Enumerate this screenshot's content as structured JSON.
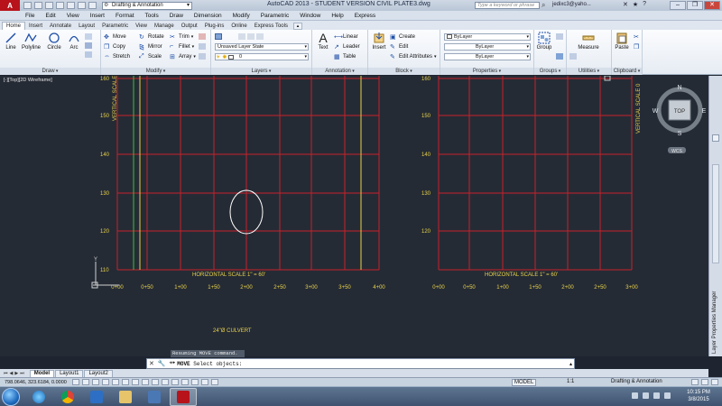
{
  "titlebar": {
    "logo": "A",
    "workspace": "Drafting & Annotation",
    "title": "AutoCAD 2013 - STUDENT VERSION    CIVIL PLATE3.dwg",
    "search_placeholder": "Type a keyword or phrase",
    "user": "jedixc3@yaho..."
  },
  "menu": [
    "File",
    "Edit",
    "View",
    "Insert",
    "Format",
    "Tools",
    "Draw",
    "Dimension",
    "Modify",
    "Parametric",
    "Window",
    "Help",
    "Express"
  ],
  "ribbon_tabs": [
    "Home",
    "Insert",
    "Annotate",
    "Layout",
    "Parametric",
    "View",
    "Manage",
    "Output",
    "Plug-ins",
    "Online",
    "Express Tools"
  ],
  "ribbon": {
    "draw": {
      "title": "Draw",
      "line": "Line",
      "polyline": "Polyline",
      "circle": "Circle",
      "arc": "Arc"
    },
    "modify": {
      "title": "Modify",
      "move": "Move",
      "rotate": "Rotate",
      "trim": "Trim",
      "copy": "Copy",
      "mirror": "Mirror",
      "fillet": "Fillet",
      "stretch": "Stretch",
      "scale": "Scale",
      "array": "Array"
    },
    "layers": {
      "title": "Layers",
      "state": "Unsaved Layer State",
      "current": "0"
    },
    "annotation": {
      "title": "Annotation",
      "text": "Text",
      "linear": "Linear",
      "leader": "Leader",
      "table": "Table"
    },
    "block": {
      "title": "Block",
      "insert": "Insert",
      "create": "Create",
      "edit": "Edit",
      "edit_attributes": "Edit Attributes"
    },
    "properties": {
      "title": "Properties",
      "color": "ByLayer",
      "linetype": "ByLayer",
      "lineweight": "ByLayer"
    },
    "groups": {
      "title": "Groups",
      "group": "Group"
    },
    "utilities": {
      "title": "Utilities",
      "measure": "Measure"
    },
    "clipboard": {
      "title": "Clipboard",
      "paste": "Paste"
    }
  },
  "viewport": {
    "label": "[-][Top][2D Wireframe]",
    "viewcube": {
      "n": "N",
      "s": "S",
      "e": "E",
      "w": "W",
      "face": "TOP",
      "wcs": "WCS"
    }
  },
  "drawing": {
    "colors": {
      "grid": "#c8202a",
      "text": "#e8d24a",
      "green": "#3bbf3b",
      "ellipse": "#ffffff"
    },
    "vertical_label": "VERTICAL SCALE 0",
    "horizontal_label": "HORIZONTAL SCALE  1\" = 60'",
    "y_ticks_left": [
      "160",
      "150",
      "140",
      "130",
      "120",
      "110"
    ],
    "y_ticks_right": [
      "160",
      "150",
      "140",
      "130",
      "120"
    ],
    "x_ticks_left": [
      "0+00",
      "0+50",
      "1+00",
      "1+50",
      "2+00",
      "2+50",
      "3+00",
      "3+50",
      "4+00"
    ],
    "x_ticks_right": [
      "0+00",
      "0+50",
      "1+00",
      "1+50",
      "2+00",
      "2+50",
      "3+00"
    ],
    "culvert_note": "24\"Ø CULVERT",
    "ucs_y": "Y"
  },
  "command": {
    "history": "Resuming MOVE command.",
    "prompt_cmd": "MOVE",
    "prompt_text": " Select objects:"
  },
  "layout_tabs": [
    "Model",
    "Layout1",
    "Layout2"
  ],
  "status": {
    "coords": "798.0646, 323.6184, 0.0000",
    "model": "MODEL",
    "scale": "1:1",
    "workspace": "Drafting & Annotation"
  },
  "palette": {
    "layer_manager": "Layer Properties Manager"
  },
  "taskbar": {
    "time": "10:15 PM",
    "date": "3/8/2015"
  }
}
